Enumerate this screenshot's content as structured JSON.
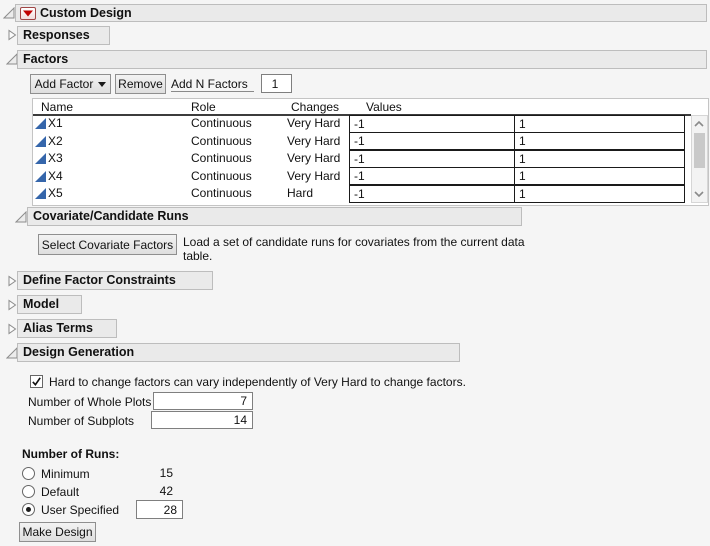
{
  "window": {
    "title": "Custom Design"
  },
  "colors": {
    "accent_red_triangle": "#c00000",
    "factor_icon_blue": "#3566ab",
    "header_bar_bg": "#eaeaea"
  },
  "icons": {
    "disclosure_expanded": "open-triangle-down-right",
    "disclosure_collapsed": "open-triangle-right",
    "red_triangle_menu": "red-down-triangle",
    "continuous_factor": "blue-right-triangle",
    "dropdown_arrow": "black-down-triangle"
  },
  "sections": {
    "responses": {
      "title": "Responses"
    },
    "factors": {
      "title": "Factors",
      "toolbar": {
        "add_factor_label": "Add Factor",
        "remove_label": "Remove",
        "add_n_factors_label": "Add N Factors",
        "add_n_factors_value": "1"
      },
      "table": {
        "columns": [
          "Name",
          "Role",
          "Changes",
          "Values"
        ],
        "rows": [
          {
            "name": "X1",
            "role": "Continuous",
            "changes": "Very Hard",
            "values": [
              "-1",
              "1"
            ]
          },
          {
            "name": "X2",
            "role": "Continuous",
            "changes": "Very Hard",
            "values": [
              "-1",
              "1"
            ]
          },
          {
            "name": "X3",
            "role": "Continuous",
            "changes": "Very Hard",
            "values": [
              "-1",
              "1"
            ]
          },
          {
            "name": "X4",
            "role": "Continuous",
            "changes": "Very Hard",
            "values": [
              "-1",
              "1"
            ]
          },
          {
            "name": "X5",
            "role": "Continuous",
            "changes": "Hard",
            "values": [
              "-1",
              "1"
            ]
          }
        ]
      }
    },
    "covariate": {
      "title": "Covariate/Candidate Runs",
      "button_label": "Select Covariate Factors",
      "description_line1": "Load a set of candidate runs for covariates from the current data",
      "description_line2": "table."
    },
    "define_factor_constraints": {
      "title": "Define Factor Constraints"
    },
    "model": {
      "title": "Model"
    },
    "alias_terms": {
      "title": "Alias Terms"
    },
    "design_generation": {
      "title": "Design Generation",
      "checkbox_label": "Hard to change factors can vary independently of Very Hard to change factors.",
      "checkbox_checked": true,
      "whole_plots_label": "Number of Whole Plots",
      "whole_plots_value": "7",
      "subplots_label": "Number of Subplots",
      "subplots_value": "14",
      "runs_title": "Number of Runs:",
      "runs_options": [
        {
          "label": "Minimum",
          "value": "15",
          "selected": false
        },
        {
          "label": "Default",
          "value": "42",
          "selected": false
        },
        {
          "label": "User Specified",
          "value": "28",
          "selected": true
        }
      ],
      "make_design_label": "Make Design"
    }
  }
}
